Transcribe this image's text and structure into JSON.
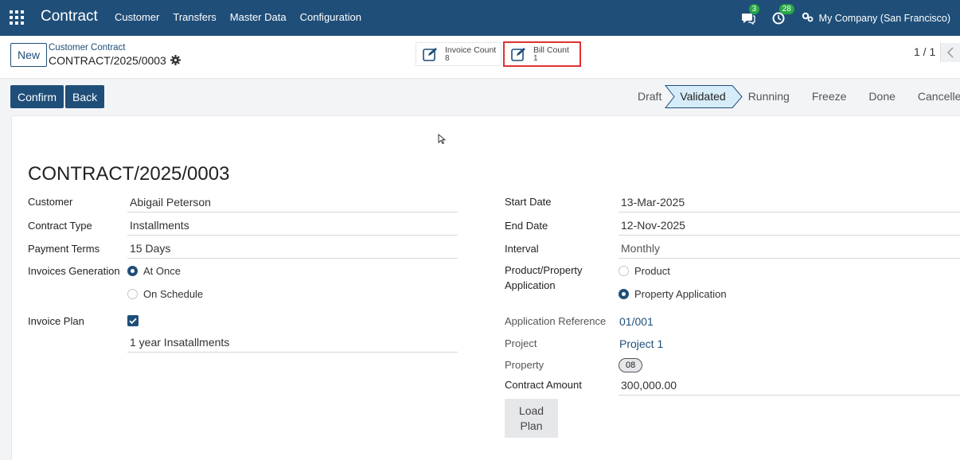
{
  "navbar": {
    "app_title": "Contract",
    "menu": [
      "Customer",
      "Transfers",
      "Master Data",
      "Configuration"
    ],
    "messages_badge": "3",
    "activities_badge": "28",
    "company": "My Company (San Francisco)"
  },
  "control": {
    "new_label": "New",
    "breadcrumb_parent": "Customer Contract",
    "breadcrumb_current": "CONTRACT/2025/0003",
    "invoice_count_label": "Invoice Count",
    "invoice_count_value": "8",
    "bill_count_label": "Bill Count",
    "bill_count_value": "1",
    "pager": "1 / 1"
  },
  "actions": {
    "confirm_label": "Confirm",
    "back_label": "Back"
  },
  "statusbar": {
    "stages": [
      "Draft",
      "Validated",
      "Running",
      "Freeze",
      "Done",
      "Cancelled"
    ],
    "active": "Validated"
  },
  "form": {
    "title": "CONTRACT/2025/0003",
    "customer_label": "Customer",
    "customer": "Abigail Peterson",
    "contract_type_label": "Contract Type",
    "contract_type": "Installments",
    "payment_terms_label": "Payment Terms",
    "payment_terms": "15 Days",
    "invoices_generation_label": "Invoices Generation",
    "invoices_generation_options": [
      "At Once",
      "On Schedule"
    ],
    "invoices_generation_selected": "At Once",
    "invoice_plan_label": "Invoice Plan",
    "invoice_plan_checked": true,
    "invoice_plan_value": "1 year Insatallments",
    "start_date_label": "Start Date",
    "start_date": "13-Mar-2025",
    "end_date_label": "End Date",
    "end_date": "12-Nov-2025",
    "interval_label": "Interval",
    "interval": "Monthly",
    "product_property_label_1": "Product/Property",
    "product_property_label_2": "Application",
    "product_property_options": [
      "Product",
      "Property Application"
    ],
    "product_property_selected": "Property Application",
    "application_reference_label": "Application Reference",
    "application_reference": "01/001",
    "project_label": "Project",
    "project": "Project 1",
    "property_label": "Property",
    "property_tag": "08",
    "contract_amount_label": "Contract Amount",
    "contract_amount": "300,000.00",
    "load_plan_line1": "Load",
    "load_plan_line2": "Plan"
  },
  "colors": {
    "primary": "#1f4e79",
    "badge": "#28a745",
    "highlight": "#e03131",
    "active_stage": "#d6ecf8"
  }
}
